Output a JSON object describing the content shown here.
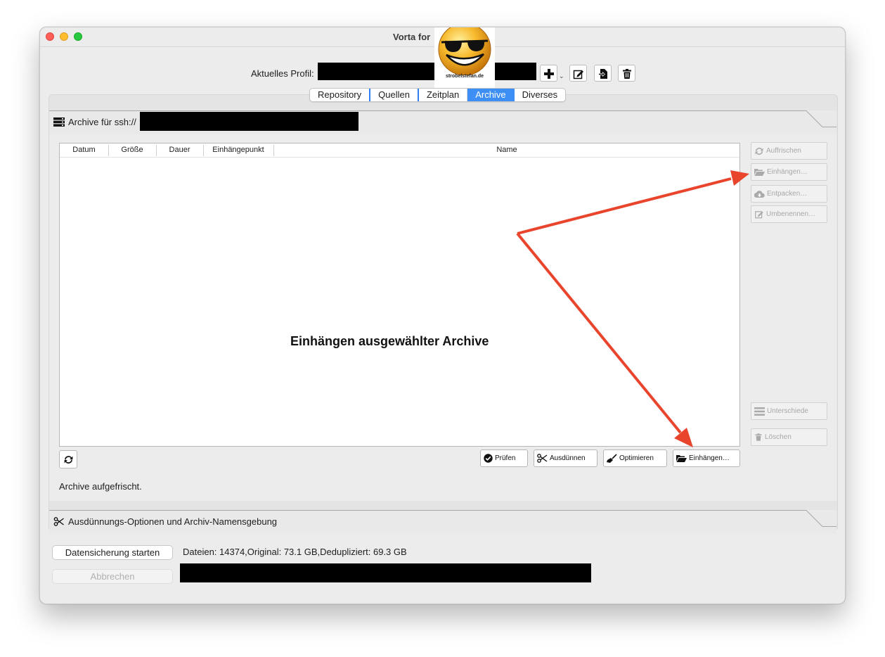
{
  "window": {
    "title": "Vorta for"
  },
  "logo": {
    "caption": "strobelstefan.de"
  },
  "profile": {
    "label": "Aktuelles Profil:"
  },
  "toolbar_icons": [
    "plus-icon",
    "edit-icon",
    "import-icon",
    "trash-icon"
  ],
  "tabs": [
    {
      "label": "Repository",
      "active": false
    },
    {
      "label": "Quellen",
      "active": false
    },
    {
      "label": "Zeitplan",
      "active": false
    },
    {
      "label": "Archive",
      "active": true
    },
    {
      "label": "Diverses",
      "active": false
    }
  ],
  "archive_group": {
    "title": "Archive für ssh://"
  },
  "table": {
    "columns": [
      "Datum",
      "Größe",
      "Dauer",
      "Einhängepunkt",
      "Name"
    ],
    "rows": []
  },
  "annotation": {
    "text": "Einhängen ausgewählter Archive",
    "color": "#e8452c"
  },
  "side_buttons": {
    "refresh": "Auffrischen",
    "mount": "Einhängen…",
    "extract": "Entpacken…",
    "rename": "Umbenennen…",
    "diff": "Unterschiede",
    "delete": "Löschen"
  },
  "bottom_buttons": {
    "check": "Prüfen",
    "prune": "Ausdünnen",
    "compact": "Optimieren",
    "mount": "Einhängen…"
  },
  "status": {
    "text": "Archive aufgefrischt."
  },
  "prune_group": {
    "title": "Ausdünnungs-Optionen und Archiv-Namensgebung"
  },
  "footer": {
    "start_label": "Datensicherung starten",
    "cancel_label": "Abbrechen",
    "stats": "Dateien: 14374,Original: 73.1 GB,Dedupliziert: 69.3 GB"
  },
  "colors": {
    "accent": "#3d8ff6",
    "arrow": "#e8452c"
  }
}
